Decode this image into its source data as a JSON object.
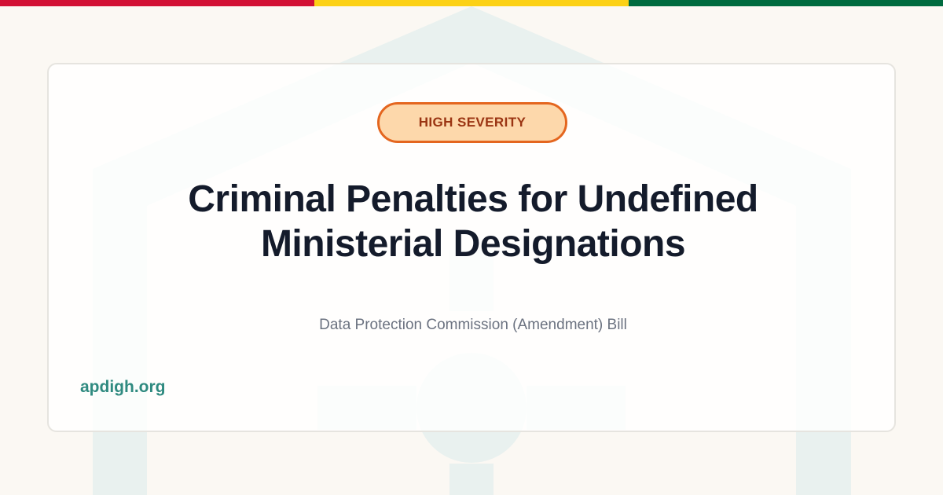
{
  "flag_colors": {
    "red": "#d21034",
    "gold": "#fcd116",
    "green": "#006b3f"
  },
  "watermark": {
    "icon": "house-lock-icon",
    "color": "#e9f1ef"
  },
  "card": {
    "badge_label": "HIGH SEVERITY",
    "badge_colors": {
      "fill": "#fdd8ab",
      "border": "#e4661f",
      "text": "#9a3412"
    },
    "title": "Criminal Penalties for Undefined Ministerial Designations",
    "subtitle": "Data Protection Commission (Amendment) Bill",
    "site": "apdigh.org",
    "site_color": "#2f8a80"
  }
}
